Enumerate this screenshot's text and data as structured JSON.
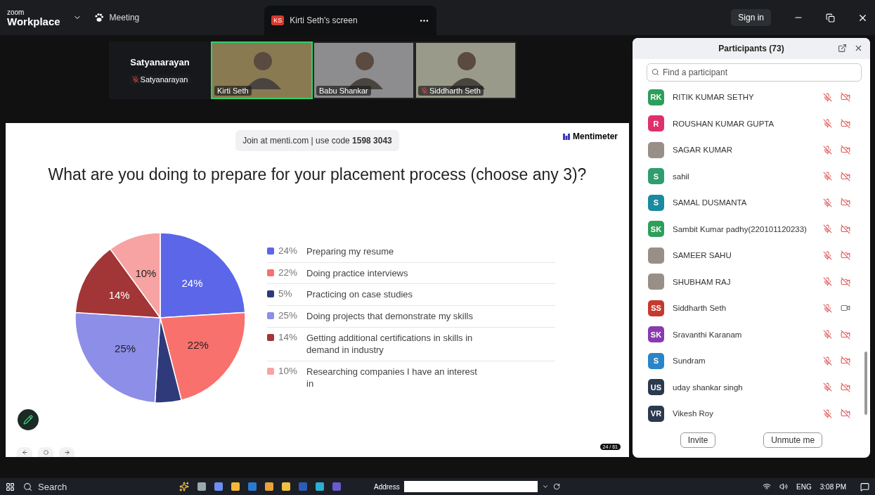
{
  "title_bar": {
    "app_small": "zoom",
    "app_name": "Workplace",
    "meeting_label": "Meeting",
    "share_tab": {
      "initials": "KS",
      "label": "Kirti Seth's screen"
    },
    "sign_in": "Sign in"
  },
  "video_strip": [
    {
      "kind": "name",
      "name": "Satyanarayan",
      "tag": "Satyanarayan",
      "muted": true,
      "speaking": false
    },
    {
      "kind": "video",
      "tag": "Kirti Seth",
      "muted": false,
      "speaking": true
    },
    {
      "kind": "video",
      "tag": "Babu Shankar",
      "muted": false,
      "speaking": false
    },
    {
      "kind": "video",
      "tag": "Siddharth Seth",
      "muted": true,
      "speaking": false
    }
  ],
  "slide": {
    "join_text": "Join at menti.com | use code **1598 3043**",
    "brand": "Mentimeter",
    "question": "What are you doing to prepare for your placement process (choose any 3)?",
    "chart_data": {
      "type": "pie",
      "categories": [
        "Preparing my resume",
        "Doing practice interviews",
        "Practicing on case studies",
        "Doing projects that demonstrate my skills",
        "Getting additional certifications in skills in demand in industry",
        "Researching companies I have an interest in"
      ],
      "series": [
        {
          "values": [
            24,
            22,
            5,
            25,
            14,
            10
          ]
        }
      ],
      "colors": [
        "#5b67e8",
        "#f8716c",
        "#2e3a7a",
        "#8c8ee8",
        "#a23535",
        "#f7a3a3"
      ],
      "value_labels": [
        "24%",
        "22%",
        "5%",
        "25%",
        "14%",
        "10%"
      ]
    },
    "slice_labels": [
      {
        "kind": "text",
        "text": "24%"
      },
      {
        "kind": "text",
        "text": "22%"
      },
      {
        "kind": "none"
      },
      {
        "kind": "text",
        "text": "25%"
      },
      {
        "kind": "text",
        "text": "14%"
      },
      {
        "kind": "text",
        "text": "10%"
      }
    ],
    "page_counter": "24 / 61"
  },
  "participants": {
    "title": "Participants (73)",
    "search": {
      "placeholder": "Find a participant"
    },
    "items": [
      {
        "kind": "initials",
        "initials": "RK",
        "color": "#2e9e5b",
        "name": "RITIK KUMAR SETHY",
        "video_off": true
      },
      {
        "kind": "initials",
        "initials": "R",
        "color": "#e0306b",
        "name": "ROUSHAN KUMAR GUPTA",
        "video_off": true
      },
      {
        "kind": "photo",
        "name": "SAGAR KUMAR",
        "video_off": true
      },
      {
        "kind": "initials",
        "initials": "S",
        "color": "#2e9e6e",
        "name": "sahil",
        "video_off": true
      },
      {
        "kind": "initials",
        "initials": "S",
        "color": "#1a8aa0",
        "name": "SAMAL DUSMANTA",
        "video_off": true
      },
      {
        "kind": "initials",
        "initials": "SK",
        "color": "#2e9e5b",
        "name": "Sambit Kumar padhy(220101120233)",
        "video_off": true
      },
      {
        "kind": "photo",
        "name": "SAMEER SAHU",
        "video_off": true
      },
      {
        "kind": "photo",
        "name": "SHUBHAM RAJ",
        "video_off": true
      },
      {
        "kind": "initials",
        "initials": "SS",
        "color": "#c63a2e",
        "name": "Siddharth Seth",
        "video_off": false
      },
      {
        "kind": "initials",
        "initials": "SK",
        "color": "#8a3ab0",
        "name": "Sravanthi Karanam",
        "video_off": true
      },
      {
        "kind": "initials",
        "initials": "S",
        "color": "#2a85c8",
        "name": "Sundram",
        "video_off": true
      },
      {
        "kind": "initials",
        "initials": "US",
        "color": "#2b3a4e",
        "name": "uday shankar singh",
        "video_off": true
      },
      {
        "kind": "initials",
        "initials": "VR",
        "color": "#2b3a4e",
        "name": "Vikesh Roy",
        "video_off": true
      }
    ],
    "buttons": [
      "Invite",
      "Unmute me"
    ]
  },
  "taskbar": {
    "search": "Search",
    "address_label": "Address",
    "language": "ENG",
    "time": "3:08 PM"
  }
}
